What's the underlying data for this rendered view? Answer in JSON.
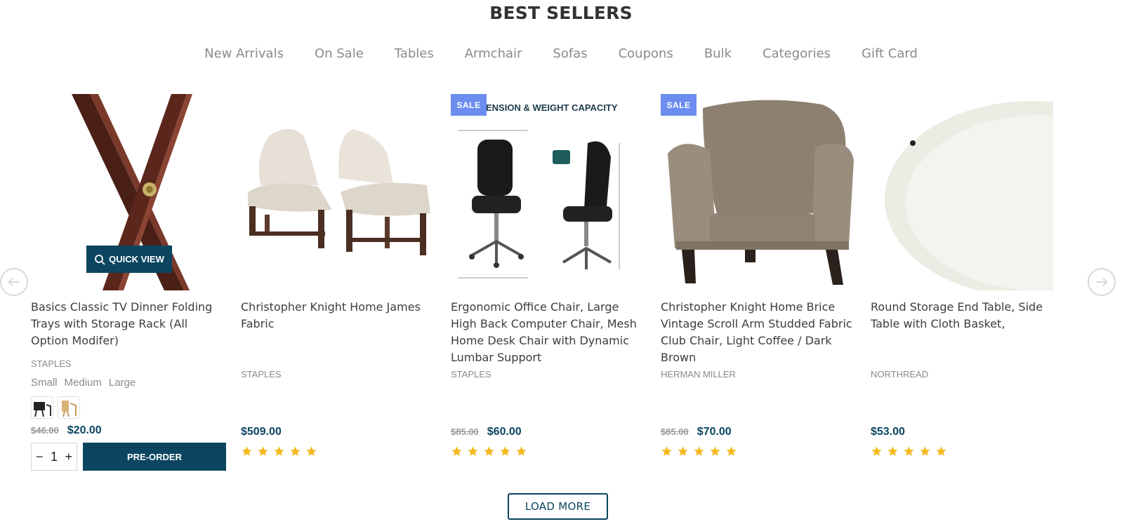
{
  "section_title": "BEST SELLERS",
  "tabs": [
    "New Arrivals",
    "On Sale",
    "Tables",
    "Armchair",
    "Sofas",
    "Coupons",
    "Bulk",
    "Categories",
    "Gift Card"
  ],
  "colors": {
    "accent": "#0b4560",
    "sale_badge": "#6c8def",
    "star": "#f6b820",
    "muted": "#8a8a8a"
  },
  "quick_view_label": "QUICK VIEW",
  "sale_label": "SALE",
  "load_more_label": "LOAD MORE",
  "products": [
    {
      "name": "Basics Classic TV Dinner Folding Trays with Storage Rack (All Option Modifer)",
      "brand": "STAPLES",
      "variants": [
        "Small",
        "Medium",
        "Large"
      ],
      "swatches": [
        "dark-swatch",
        "natural-swatch"
      ],
      "old_price": "$46.00",
      "price": "$20.00",
      "quantity": "1",
      "action_label": "PRE-ORDER",
      "image_icon": "folding-tray-image"
    },
    {
      "name": "Christopher Knight Home James Fabric",
      "brand": "STAPLES",
      "price": "$509.00",
      "rating": 5,
      "image_icon": "dining-chairs-image"
    },
    {
      "name": "Ergonomic Office Chair, Large High Back Computer Chair, Mesh Home Desk Chair with Dynamic Lumbar Support",
      "brand": "STAPLES",
      "old_price": "$85.00",
      "price": "$60.00",
      "rating": 5,
      "sale": true,
      "image_banner": "ENSION & WEIGHT CAPACITY",
      "image_icon": "office-chair-image"
    },
    {
      "name": "Christopher Knight Home Brice Vintage Scroll Arm Studded Fabric Club Chair, Light Coffee / Dark Brown",
      "brand": "HERMAN MILLER",
      "old_price": "$85.00",
      "price": "$70.00",
      "rating": 5,
      "sale": true,
      "image_icon": "club-chair-image"
    },
    {
      "name": "Round Storage End Table, Side Table with Cloth Basket,",
      "brand": "NORTHREAD",
      "price": "$53.00",
      "rating": 5,
      "image_icon": "round-table-image"
    }
  ]
}
